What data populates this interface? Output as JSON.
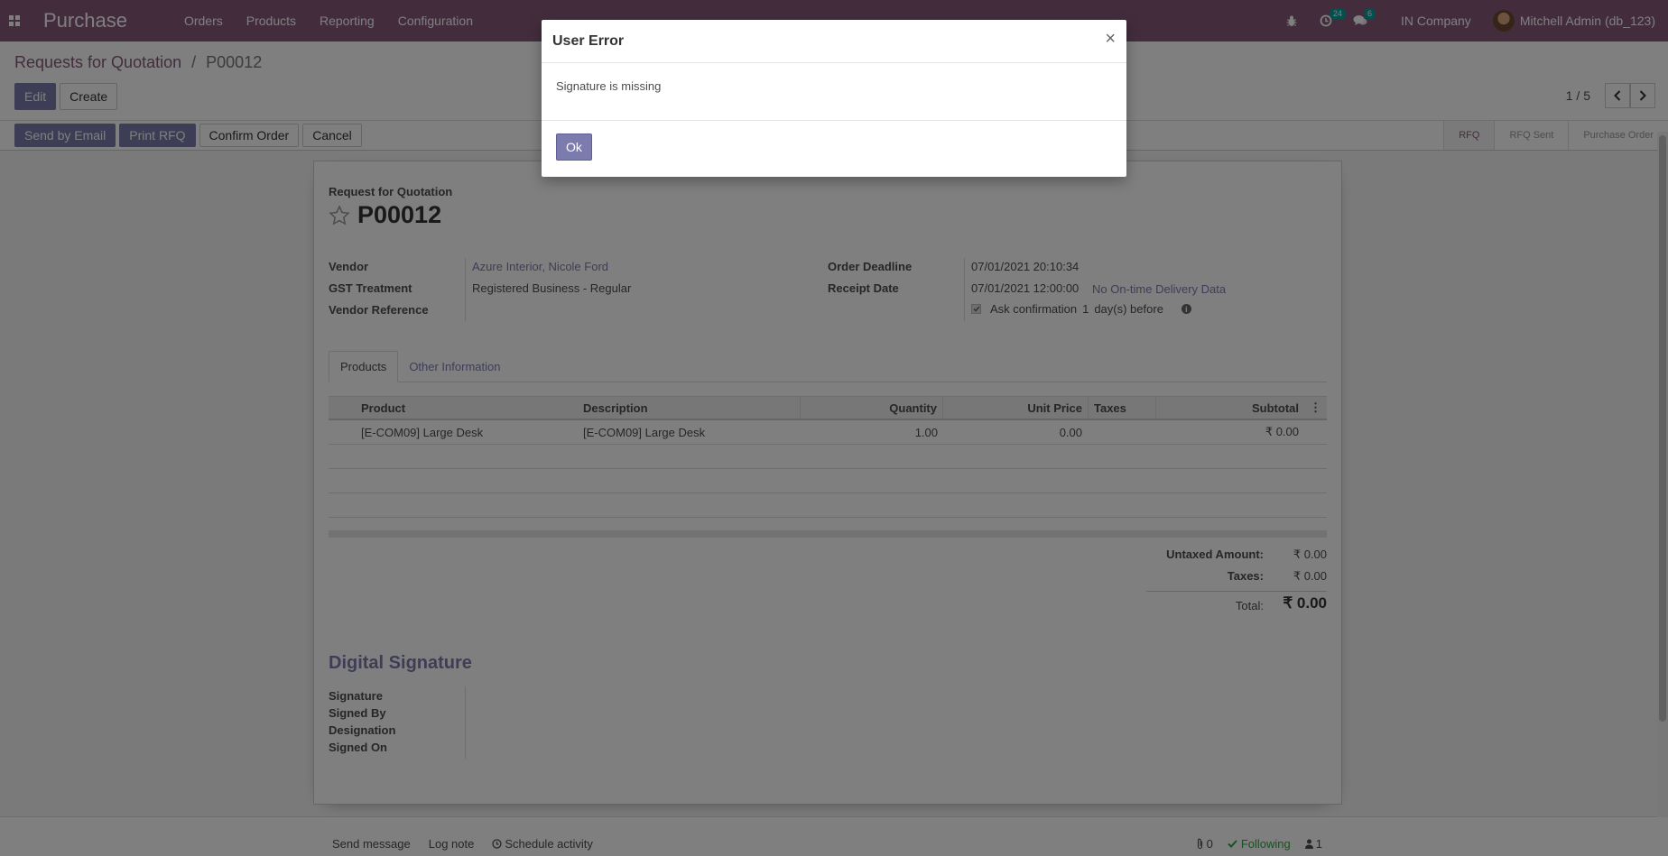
{
  "navbar": {
    "app_name": "Purchase",
    "menu": [
      "Orders",
      "Products",
      "Reporting",
      "Configuration"
    ],
    "activity_count": "24",
    "message_count": "6",
    "company": "IN Company",
    "user": "Mitchell Admin (db_123)",
    "bg_color": "#875a7b"
  },
  "breadcrumb": {
    "parent": "Requests for Quotation",
    "separator": "/",
    "current": "P00012"
  },
  "control": {
    "edit_label": "Edit",
    "create_label": "Create",
    "pager_value": "1 / 5"
  },
  "status": {
    "buttons": [
      "Send by Email",
      "Print RFQ",
      "Confirm Order",
      "Cancel"
    ],
    "stages": [
      "RFQ",
      "RFQ Sent",
      "Purchase Order"
    ],
    "current_stage": "RFQ"
  },
  "form": {
    "doc_label": "Request for Quotation",
    "doc_name": "P00012",
    "left_fields": [
      {
        "label": "Vendor",
        "value": "Azure Interior, Nicole Ford"
      },
      {
        "label": "GST Treatment",
        "value": "Registered Business - Regular"
      },
      {
        "label": "Vendor Reference",
        "value": ""
      }
    ],
    "right_fields": [
      {
        "label": "Order Deadline",
        "value": "07/01/2021 20:10:34"
      },
      {
        "label": "Receipt Date",
        "value": "07/01/2021 12:00:00"
      }
    ],
    "on_time_link": "No On-time Delivery Data",
    "ask_confirmation": "Ask confirmation",
    "confirm_days": "1",
    "days_before": "day(s) before",
    "tabs": [
      "Products",
      "Other Information"
    ],
    "columns": [
      "Product",
      "Description",
      "Quantity",
      "Unit Price",
      "Taxes",
      "Subtotal"
    ],
    "lines": [
      {
        "product": "[E-COM09] Large Desk",
        "description": "[E-COM09] Large Desk",
        "quantity": "1.00",
        "unit_price": "0.00",
        "taxes": "",
        "subtotal": "₹ 0.00"
      }
    ],
    "totals": {
      "untaxed_label": "Untaxed Amount:",
      "untaxed_value": "₹ 0.00",
      "taxes_label": "Taxes:",
      "taxes_value": "₹ 0.00",
      "total_label": "Total:",
      "total_value": "₹ 0.00"
    },
    "signature_title": "Digital Signature",
    "signature_fields": [
      "Signature",
      "Signed By",
      "Designation",
      "Signed On"
    ]
  },
  "chatter": {
    "send_message": "Send message",
    "log_note": "Log note",
    "schedule_activity": "Schedule activity",
    "attachments": "0",
    "following": "Following",
    "followers": "1"
  },
  "dialog": {
    "title": "User Error",
    "close": "×",
    "message": "Signature is missing",
    "ok_label": "Ok"
  }
}
